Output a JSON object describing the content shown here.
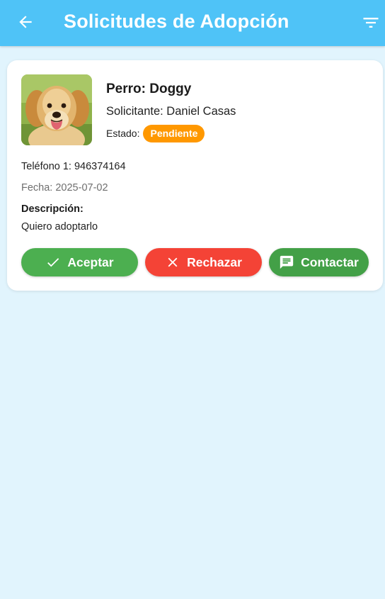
{
  "appbar": {
    "title": "Solicitudes de Adopción",
    "back_icon": "arrow-left-icon",
    "filter_icon": "filter-list-icon",
    "background_color": "#4fc3f7"
  },
  "request": {
    "pet_name": "Perro: Doggy",
    "applicant": "Solicitante: Daniel Casas",
    "status_label": "Estado:",
    "status": "Pendiente",
    "status_color": "#ff9800",
    "phone": "Teléfono 1: 946374164",
    "date": "Fecha: 2025-07-02",
    "description_label": "Descripción:",
    "description": "Quiero adoptarlo",
    "photo_icon": "dog-photo"
  },
  "actions": {
    "accept": {
      "label": "Aceptar",
      "icon": "check-icon",
      "color": "#4caf50"
    },
    "reject": {
      "label": "Rechazar",
      "icon": "close-icon",
      "color": "#f44336"
    },
    "contact": {
      "label": "Contactar",
      "icon": "chat-icon",
      "color": "#43a047"
    }
  },
  "page": {
    "background_color": "#e1f4fd"
  }
}
